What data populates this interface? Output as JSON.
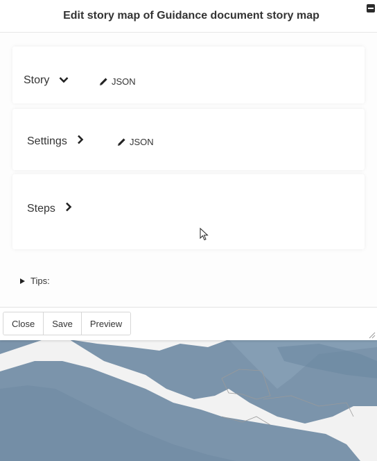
{
  "dialog": {
    "title": "Edit story map of Guidance document story map"
  },
  "sections": {
    "story": {
      "label": "Story",
      "json_label": "JSON",
      "expanded": true
    },
    "settings": {
      "label": "Settings",
      "json_label": "JSON",
      "expanded": false
    },
    "steps": {
      "label": "Steps",
      "expanded": false
    }
  },
  "tips": {
    "label": "Tips:"
  },
  "footer": {
    "close": "Close",
    "save": "Save",
    "preview": "Preview"
  },
  "icons": {
    "minimize": "minimize-icon",
    "story_chevron": "chevron-down-icon",
    "settings_chevron": "chevron-right-icon",
    "steps_chevron": "chevron-right-icon",
    "edit": "pencil-icon",
    "tips": "triangle-right-icon",
    "resize": "resize-handle-icon",
    "cursor": "mouse-cursor-icon"
  },
  "colors": {
    "sea": "#7d96ad",
    "land": "#f3f3f3"
  }
}
